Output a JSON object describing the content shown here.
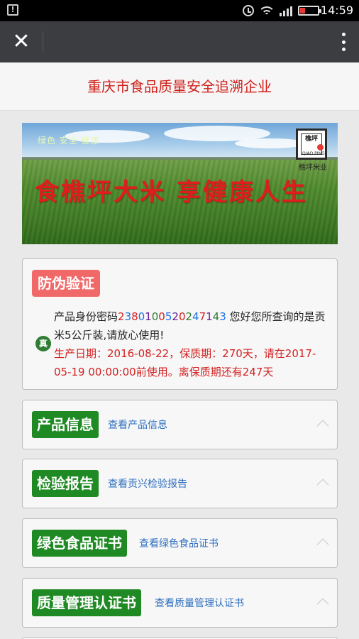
{
  "status_bar": {
    "time": "14:59",
    "icons": [
      "alert-icon",
      "alarm-icon",
      "wifi-icon",
      "signal-icon",
      "battery-low-icon"
    ],
    "battery_color": "#e53935"
  },
  "app_bar": {
    "close_glyph": "✕",
    "menu_icon": "more-vertical-icon",
    "background": "#3b3d40"
  },
  "page": {
    "title": "重庆市食品质量安全追溯企业",
    "title_color": "#d0201b"
  },
  "banner": {
    "tags": "绿色 安全 健康",
    "slogan": "食樵坪大米 享健康人生",
    "logo_text": "樵坪米业",
    "logo_mark": "樵坪",
    "logo_sub": "QIAO PING"
  },
  "verification": {
    "title": "防伪验证",
    "badge": "真",
    "prefix": "产品身份密码",
    "code": [
      {
        "d": "2",
        "c": "#d32020"
      },
      {
        "d": "3",
        "c": "#1a73e8"
      },
      {
        "d": "8",
        "c": "#d32020"
      },
      {
        "d": "0",
        "c": "#1a73e8"
      },
      {
        "d": "1",
        "c": "#6a1b9a"
      },
      {
        "d": "0",
        "c": "#2e7d32"
      },
      {
        "d": "0",
        "c": "#d32020"
      },
      {
        "d": "5",
        "c": "#1a73e8"
      },
      {
        "d": "2",
        "c": "#6a1b9a"
      },
      {
        "d": "0",
        "c": "#d32020"
      },
      {
        "d": "2",
        "c": "#2e7d32"
      },
      {
        "d": "4",
        "c": "#1a73e8"
      },
      {
        "d": "7",
        "c": "#d32020"
      },
      {
        "d": "1",
        "c": "#6a1b9a"
      },
      {
        "d": "4",
        "c": "#2e7d32"
      },
      {
        "d": "3",
        "c": "#1a73e8"
      }
    ],
    "message": " 您好您所查询的是贡米5公斤装,请放心使用!",
    "warning": "生产日期：2016-08-22，保质期：270天，请在2017-05-19 00:00:00前使用。离保质期还有247天",
    "title_bg": "#f06868",
    "warning_color": "#d32020"
  },
  "sections": [
    {
      "title": "产品信息",
      "link": "查看产品信息"
    },
    {
      "title": "检验报告",
      "link": "查看贡兴检验报告"
    },
    {
      "title": "绿色食品证书",
      "link": "查看绿色食品证书"
    },
    {
      "title": "质量管理认证书",
      "link": "查看质量管理认证书"
    }
  ],
  "colors": {
    "section_badge": "#1f8a24",
    "link": "#2f6fc0"
  }
}
